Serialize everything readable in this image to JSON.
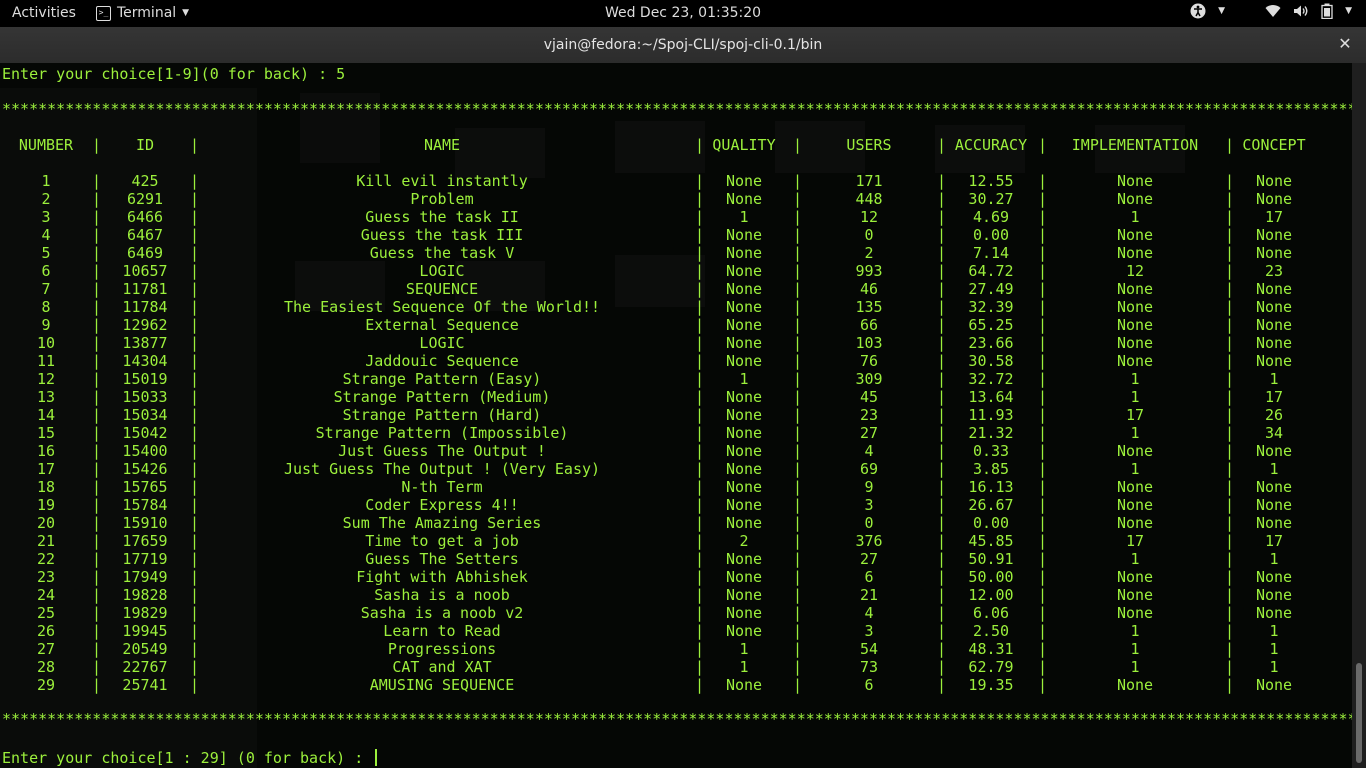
{
  "topbar": {
    "activities": "Activities",
    "app_menu": "Terminal",
    "clock": "Wed Dec 23, 01:35:20"
  },
  "window": {
    "title": "vjain@fedora:~/Spoj-CLI/spoj-cli-0.1/bin"
  },
  "terminal": {
    "prompt_top": "Enter your choice[1-9](0 for back) : 5",
    "stars": "************************************************************************************************************************************************************",
    "headers": {
      "number": "NUMBER",
      "id": "ID",
      "name": "NAME",
      "quality": "QUALITY",
      "users": "USERS",
      "accuracy": "ACCURACY",
      "implementation": "IMPLEMENTATION",
      "concept": "CONCEPT"
    },
    "rows": [
      {
        "n": "1",
        "id": "425",
        "name": "Kill evil instantly",
        "q": "None",
        "u": "171",
        "a": "12.55",
        "i": "None",
        "c": "None"
      },
      {
        "n": "2",
        "id": "6291",
        "name": "Problem",
        "q": "None",
        "u": "448",
        "a": "30.27",
        "i": "None",
        "c": "None"
      },
      {
        "n": "3",
        "id": "6466",
        "name": "Guess the task II",
        "q": "1",
        "u": "12",
        "a": "4.69",
        "i": "1",
        "c": "17"
      },
      {
        "n": "4",
        "id": "6467",
        "name": "Guess the task III",
        "q": "None",
        "u": "0",
        "a": "0.00",
        "i": "None",
        "c": "None"
      },
      {
        "n": "5",
        "id": "6469",
        "name": "Guess the task V",
        "q": "None",
        "u": "2",
        "a": "7.14",
        "i": "None",
        "c": "None"
      },
      {
        "n": "6",
        "id": "10657",
        "name": "LOGIC",
        "q": "None",
        "u": "993",
        "a": "64.72",
        "i": "12",
        "c": "23"
      },
      {
        "n": "7",
        "id": "11781",
        "name": "SEQUENCE",
        "q": "None",
        "u": "46",
        "a": "27.49",
        "i": "None",
        "c": "None"
      },
      {
        "n": "8",
        "id": "11784",
        "name": "The Easiest Sequence Of the World!!",
        "q": "None",
        "u": "135",
        "a": "32.39",
        "i": "None",
        "c": "None"
      },
      {
        "n": "9",
        "id": "12962",
        "name": "External Sequence",
        "q": "None",
        "u": "66",
        "a": "65.25",
        "i": "None",
        "c": "None"
      },
      {
        "n": "10",
        "id": "13877",
        "name": "LOGIC",
        "q": "None",
        "u": "103",
        "a": "23.66",
        "i": "None",
        "c": "None"
      },
      {
        "n": "11",
        "id": "14304",
        "name": "Jaddouic Sequence",
        "q": "None",
        "u": "76",
        "a": "30.58",
        "i": "None",
        "c": "None"
      },
      {
        "n": "12",
        "id": "15019",
        "name": "Strange Pattern (Easy)",
        "q": "1",
        "u": "309",
        "a": "32.72",
        "i": "1",
        "c": "1"
      },
      {
        "n": "13",
        "id": "15033",
        "name": "Strange Pattern (Medium)",
        "q": "None",
        "u": "45",
        "a": "13.64",
        "i": "1",
        "c": "17"
      },
      {
        "n": "14",
        "id": "15034",
        "name": "Strange Pattern (Hard)",
        "q": "None",
        "u": "23",
        "a": "11.93",
        "i": "17",
        "c": "26"
      },
      {
        "n": "15",
        "id": "15042",
        "name": "Strange Pattern (Impossible)",
        "q": "None",
        "u": "27",
        "a": "21.32",
        "i": "1",
        "c": "34"
      },
      {
        "n": "16",
        "id": "15400",
        "name": "Just Guess The Output !",
        "q": "None",
        "u": "4",
        "a": "0.33",
        "i": "None",
        "c": "None"
      },
      {
        "n": "17",
        "id": "15426",
        "name": "Just Guess The Output ! (Very Easy)",
        "q": "None",
        "u": "69",
        "a": "3.85",
        "i": "1",
        "c": "1"
      },
      {
        "n": "18",
        "id": "15765",
        "name": "N-th Term",
        "q": "None",
        "u": "9",
        "a": "16.13",
        "i": "None",
        "c": "None"
      },
      {
        "n": "19",
        "id": "15784",
        "name": "Coder Express 4!!",
        "q": "None",
        "u": "3",
        "a": "26.67",
        "i": "None",
        "c": "None"
      },
      {
        "n": "20",
        "id": "15910",
        "name": "Sum The Amazing Series",
        "q": "None",
        "u": "0",
        "a": "0.00",
        "i": "None",
        "c": "None"
      },
      {
        "n": "21",
        "id": "17659",
        "name": "Time to get a job",
        "q": "2",
        "u": "376",
        "a": "45.85",
        "i": "17",
        "c": "17"
      },
      {
        "n": "22",
        "id": "17719",
        "name": "Guess The Setters",
        "q": "None",
        "u": "27",
        "a": "50.91",
        "i": "1",
        "c": "1"
      },
      {
        "n": "23",
        "id": "17949",
        "name": "Fight with Abhishek",
        "q": "None",
        "u": "6",
        "a": "50.00",
        "i": "None",
        "c": "None"
      },
      {
        "n": "24",
        "id": "19828",
        "name": "Sasha is a noob",
        "q": "None",
        "u": "21",
        "a": "12.00",
        "i": "None",
        "c": "None"
      },
      {
        "n": "25",
        "id": "19829",
        "name": "Sasha is a noob v2",
        "q": "None",
        "u": "4",
        "a": "6.06",
        "i": "None",
        "c": "None"
      },
      {
        "n": "26",
        "id": "19945",
        "name": "Learn to Read",
        "q": "None",
        "u": "3",
        "a": "2.50",
        "i": "1",
        "c": "1"
      },
      {
        "n": "27",
        "id": "20549",
        "name": "Progressions",
        "q": "1",
        "u": "54",
        "a": "48.31",
        "i": "1",
        "c": "1"
      },
      {
        "n": "28",
        "id": "22767",
        "name": "CAT and XAT",
        "q": "1",
        "u": "73",
        "a": "62.79",
        "i": "1",
        "c": "1"
      },
      {
        "n": "29",
        "id": "25741",
        "name": "AMUSING SEQUENCE",
        "q": "None",
        "u": "6",
        "a": "19.35",
        "i": "None",
        "c": "None"
      }
    ],
    "prompt_bottom": "Enter your choice[1 : 29] (0 for back) : "
  },
  "colors": {
    "terminal_fg": "#9cf03c",
    "terminal_bg": "#050705"
  }
}
